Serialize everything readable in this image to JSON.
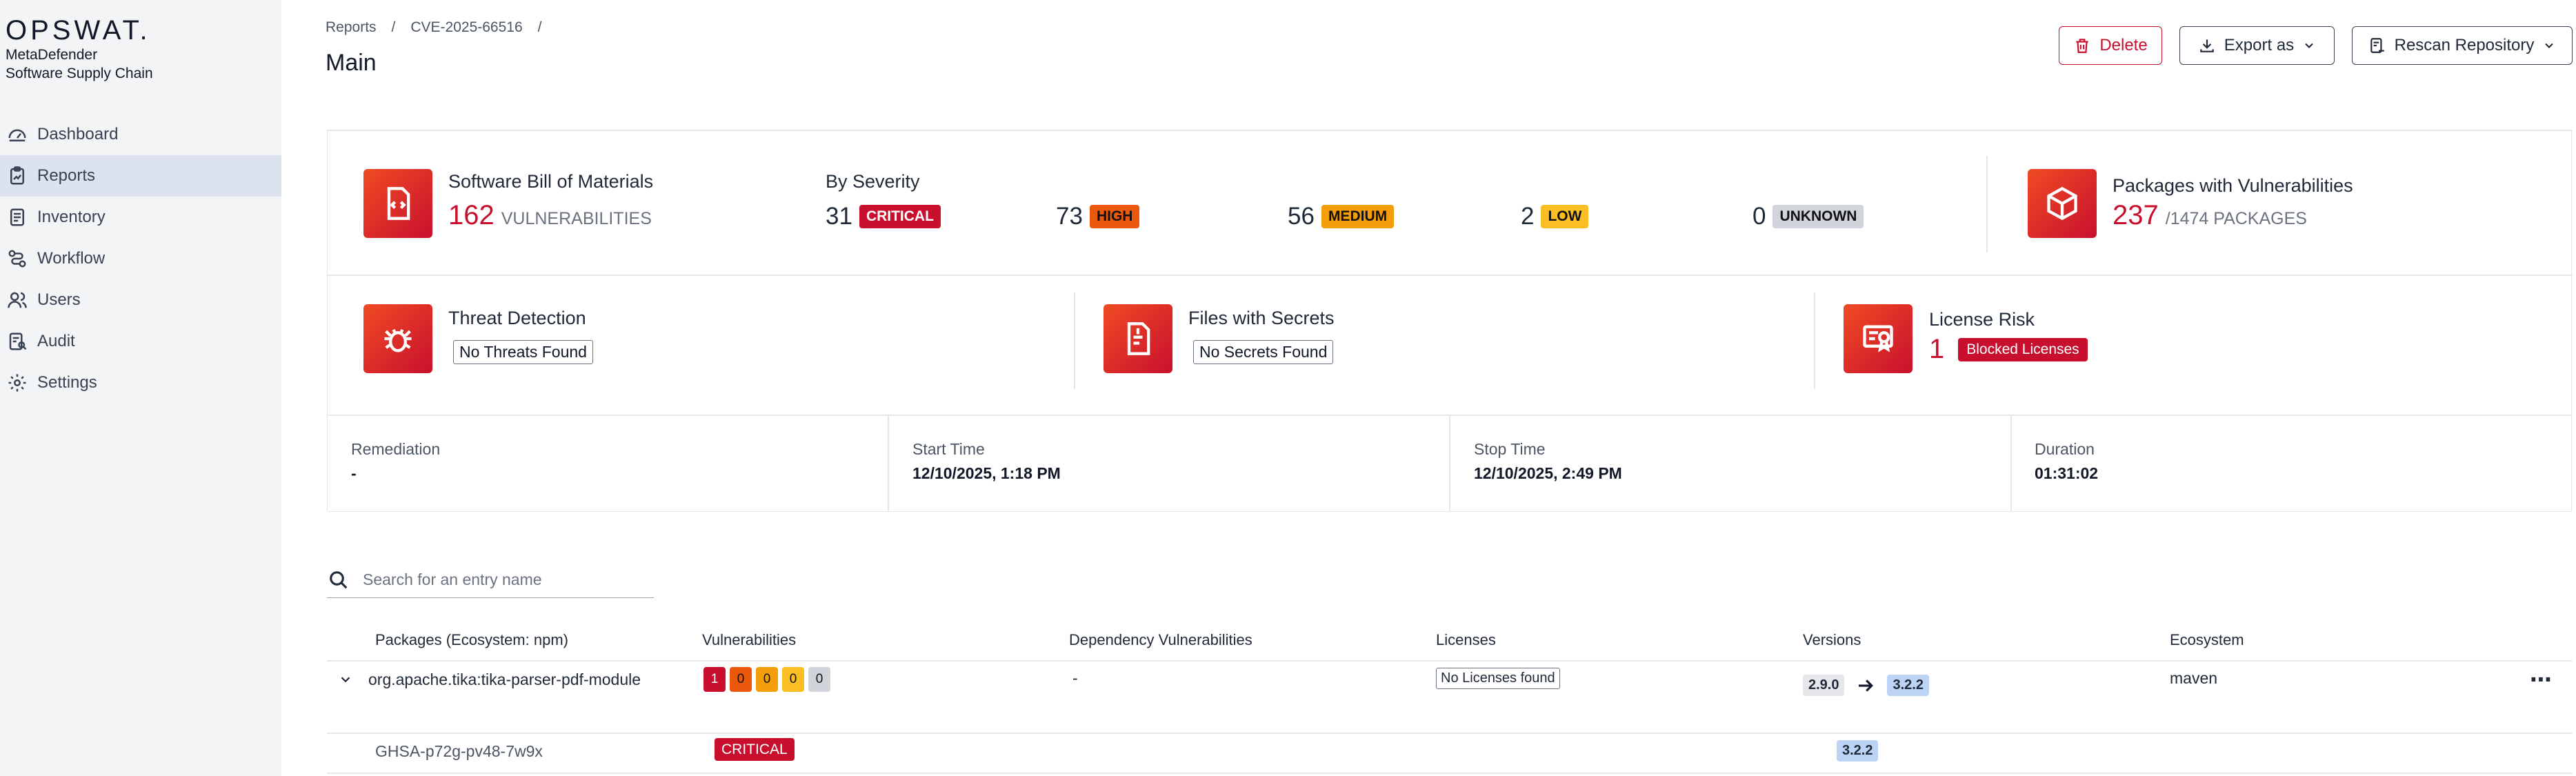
{
  "sidebar": {
    "logo": "OPSWAT.",
    "product_line1": "MetaDefender",
    "product_line2": "Software Supply Chain",
    "items": [
      {
        "label": "Dashboard",
        "icon": "gauge-icon"
      },
      {
        "label": "Reports",
        "icon": "clipboard-icon",
        "active": true
      },
      {
        "label": "Inventory",
        "icon": "list-icon"
      },
      {
        "label": "Workflow",
        "icon": "workflow-icon"
      },
      {
        "label": "Users",
        "icon": "users-icon"
      },
      {
        "label": "Audit",
        "icon": "audit-icon"
      },
      {
        "label": "Settings",
        "icon": "gear-icon"
      }
    ]
  },
  "header": {
    "breadcrumb": [
      "Reports",
      "/",
      "CVE-2025-66516",
      "/"
    ],
    "title": "Main",
    "delete_label": "Delete",
    "export_label": "Export as",
    "rescan_label": "Rescan Repository"
  },
  "summary": {
    "sbom": {
      "title": "Software Bill of Materials",
      "count": "162",
      "unit": "VULNERABILITIES"
    },
    "severity": {
      "title": "By Severity",
      "items": [
        {
          "count": "31",
          "label": "CRITICAL"
        },
        {
          "count": "73",
          "label": "HIGH"
        },
        {
          "count": "56",
          "label": "MEDIUM"
        },
        {
          "count": "2",
          "label": "LOW"
        },
        {
          "count": "0",
          "label": "UNKNOWN"
        }
      ]
    },
    "packages": {
      "title": "Packages with Vulnerabilities",
      "count": "237",
      "total": "/1474 PACKAGES"
    },
    "threat": {
      "title": "Threat Detection",
      "status": "No Threats Found"
    },
    "secrets": {
      "title": "Files with Secrets",
      "status": "No Secrets Found"
    },
    "license": {
      "title": "License Risk",
      "count": "1",
      "status": "Blocked Licenses"
    },
    "info": [
      {
        "label": "Remediation",
        "value": "-"
      },
      {
        "label": "Start Time",
        "value": "12/10/2025, 1:18 PM"
      },
      {
        "label": "Stop Time",
        "value": "12/10/2025, 2:49 PM"
      },
      {
        "label": "Duration",
        "value": "01:31:02"
      }
    ]
  },
  "search": {
    "placeholder": "Search for an entry name"
  },
  "table": {
    "headers": [
      "Packages (Ecosystem: npm)",
      "Vulnerabilities",
      "Dependency Vulnerabilities",
      "Licenses",
      "Versions",
      "Ecosystem"
    ],
    "rows": [
      {
        "package": "org.apache.tika:tika-parser-pdf-module",
        "vulns": [
          "1",
          "0",
          "0",
          "0",
          "0"
        ],
        "dependency": "-",
        "license": "No Licenses found",
        "version_from": "2.9.0",
        "version_to": "3.2.2",
        "ecosystem": "maven"
      }
    ],
    "subrow": {
      "id": "GHSA-p72g-pv48-7w9x",
      "severity": "CRITICAL",
      "version": "3.2.2"
    }
  },
  "colors": {
    "accent": "#c8102e",
    "high": "#ea580c",
    "medium": "#f59e0b",
    "low": "#fbbf24",
    "unknown": "#d1d5db"
  }
}
